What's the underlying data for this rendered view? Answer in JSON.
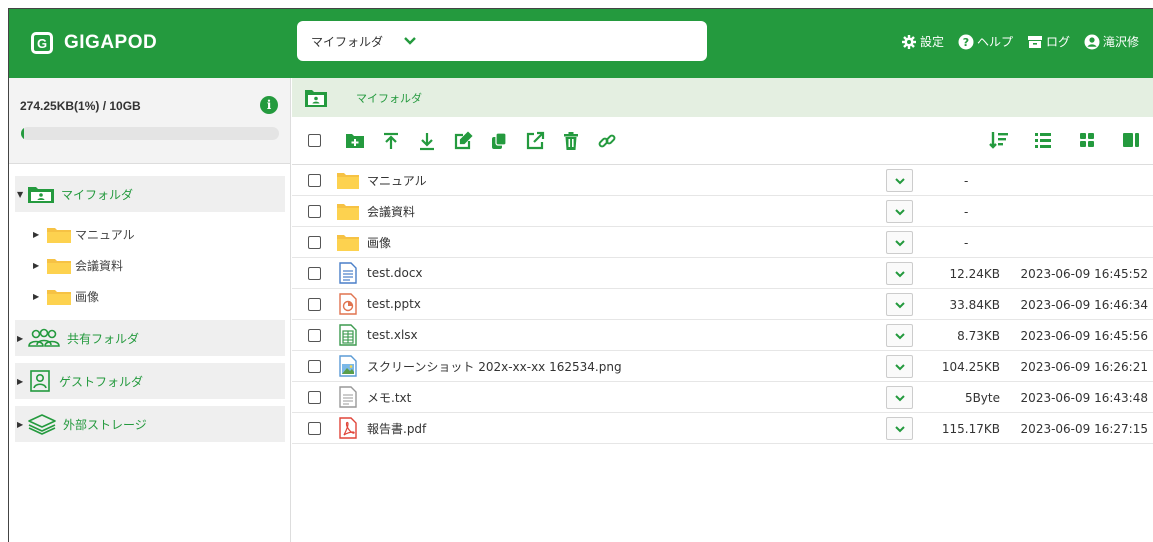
{
  "app": {
    "name": "GIGAPOD",
    "logo_letter": "G"
  },
  "header": {
    "folder_select": "マイフォルダ",
    "menu": [
      {
        "icon": "gear-icon",
        "label": "設定"
      },
      {
        "icon": "help-icon",
        "label": "ヘルプ"
      },
      {
        "icon": "log-icon",
        "label": "ログ"
      },
      {
        "icon": "user-icon",
        "label": "滝沢修"
      }
    ]
  },
  "storage": {
    "text": "274.25KB(1%) / 10GB",
    "used_fraction": 0.01,
    "info_glyph": "i"
  },
  "tree": {
    "my_folder": "マイフォルダ",
    "sub_items": [
      "マニュアル",
      "会議資料",
      "画像"
    ],
    "shared_folder": "共有フォルダ",
    "guest_folder": "ゲストフォルダ",
    "external_storage": "外部ストレージ"
  },
  "breadcrumb": "マイフォルダ",
  "files": [
    {
      "name": "マニュアル",
      "type": "folder",
      "size": "-",
      "date": ""
    },
    {
      "name": "会議資料",
      "type": "folder",
      "size": "-",
      "date": ""
    },
    {
      "name": "画像",
      "type": "folder",
      "size": "-",
      "date": ""
    },
    {
      "name": "test.docx",
      "type": "docx",
      "size": "12.24KB",
      "date": "2023-06-09 16:45:52"
    },
    {
      "name": "test.pptx",
      "type": "pptx",
      "size": "33.84KB",
      "date": "2023-06-09 16:46:34"
    },
    {
      "name": "test.xlsx",
      "type": "xlsx",
      "size": "8.73KB",
      "date": "2023-06-09 16:45:56"
    },
    {
      "name": "スクリーンショット 202x-xx-xx 162534.png",
      "type": "png",
      "size": "104.25KB",
      "date": "2023-06-09 16:26:21"
    },
    {
      "name": "メモ.txt",
      "type": "txt",
      "size": "5Byte",
      "date": "2023-06-09 16:43:48"
    },
    {
      "name": "報告書.pdf",
      "type": "pdf",
      "size": "115.17KB",
      "date": "2023-06-09 16:27:15"
    }
  ],
  "colors": {
    "brand": "#249a3e",
    "breadcrumb_bg": "#e4efe1",
    "folder": "#f6c244"
  }
}
